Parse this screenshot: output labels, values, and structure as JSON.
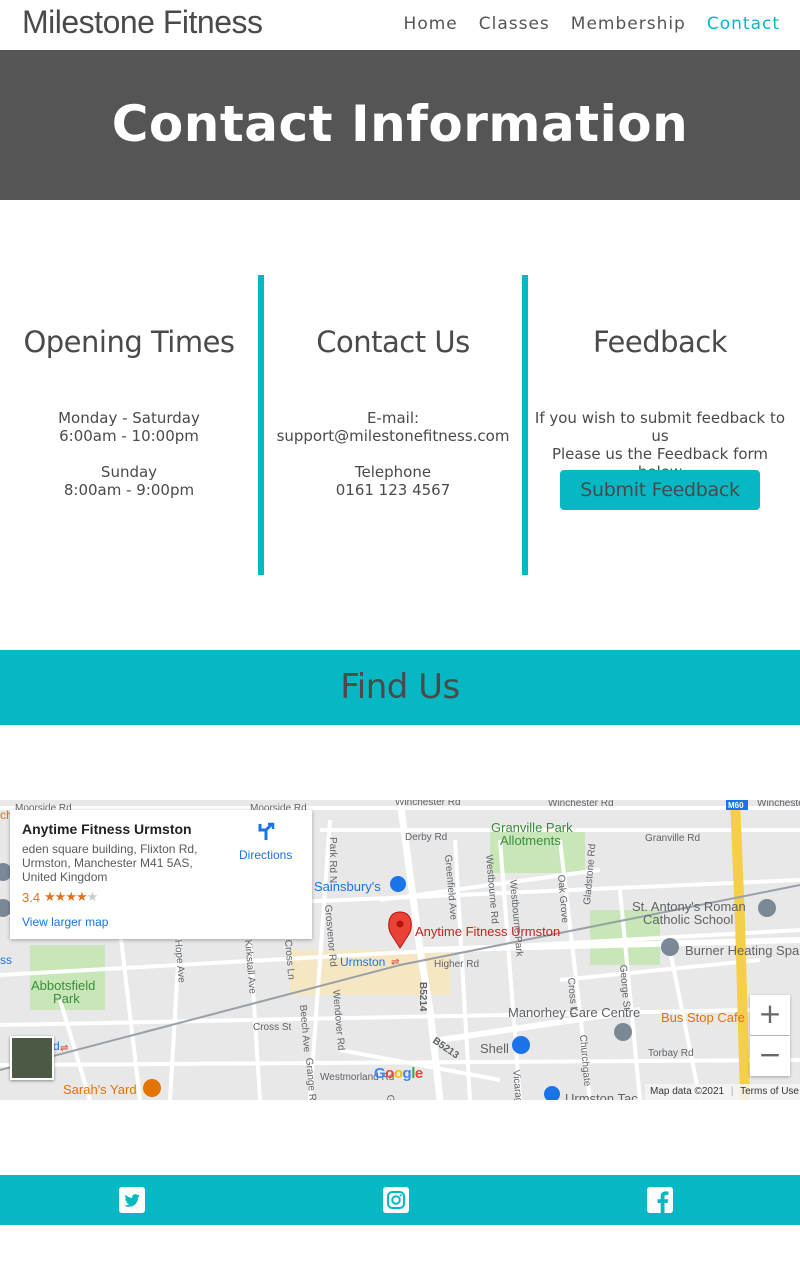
{
  "nav": {
    "brand": "Milestone Fitness",
    "links": [
      "Home",
      "Classes",
      "Membership",
      "Contact"
    ],
    "active": "Contact"
  },
  "hero": {
    "title": "Contact Information"
  },
  "opening": {
    "title": "Opening Times",
    "lines": [
      "Monday - Saturday",
      "6:00am - 10:00pm",
      "",
      "Sunday",
      "8:00am - 9:00pm"
    ]
  },
  "contact": {
    "title": "Contact Us",
    "lines": [
      "E-mail:",
      "support@milestonefitness.com",
      "",
      "Telephone",
      "0161 123 4567"
    ]
  },
  "feedback": {
    "title": "Feedback",
    "lines": [
      "If you wish to submit feedback to us",
      "Please us the Feedback form below"
    ],
    "button": "Submit Feedback"
  },
  "find": {
    "title": "Find Us"
  },
  "map": {
    "place_name": "Anytime Fitness Urmston",
    "address": "eden square building, Flixton Rd, Urmston, Manchester M41 5AS, United Kingdom",
    "rating": "3.4",
    "rating_value": 3.4,
    "rating_max": 5,
    "larger_map": "View larger map",
    "directions": "Directions",
    "marker_label": "Anytime Fitness Urmston",
    "google": "Google",
    "map_data": "Map data ©2021",
    "terms": "Terms of Use",
    "zoom_in": "+",
    "zoom_out": "−",
    "labels": {
      "moorside1": "Moorside Rd",
      "moorside2": "Moorside Rd",
      "winchester1": "Winchester Rd",
      "winchester2": "Winchester Rd",
      "winchester3": "Winchester",
      "m60": "M60",
      "derby": "Derby Rd",
      "park": "Park Rd N",
      "granville_park": "Granville Park",
      "allotments": "Allotments",
      "granville_rd": "Granville Rd",
      "sainsburys": "Sainsbury's",
      "greenfield": "Greenfield Ave",
      "westbourne": "Westbourne Rd",
      "westbourne_park": "Westbourne Park",
      "oak_grove": "Oak Grove",
      "gladstone": "Gladstone Rd",
      "st_antonys_1": "St. Antony's Roman",
      "st_antonys_2": "Catholic School",
      "burner": "Burner Heating Spa",
      "urmston": "Urmston",
      "higher_rd": "Higher Rd",
      "b5214": "B5214",
      "b5213": "B5213",
      "abbotsfield_1": "Abbotsfield",
      "abbotsfield_2": "Park",
      "grosvenor": "Grosvenor Rd",
      "manorhey": "Manorhey Care Centre",
      "bus_stop": "Bus Stop Cafe",
      "shell": "Shell",
      "cross_st": "Cross St",
      "beech": "Beech Ave",
      "wendover": "Wendover Rd",
      "grange": "Grange Rd",
      "westmorland": "Westmorland Rd",
      "torbay": "Torbay Rd",
      "george": "George St",
      "cross_ln": "Cross Ln",
      "churchgate": "Churchgate",
      "sarahs": "Sarah's Yard",
      "urmston_tac": "Urmston Tac",
      "vicarage": "Vicarage Rd",
      "kirkstall": "Kirkstall Ave",
      "hope": "Hope Ave",
      "edge_ch": "ch",
      "edge_d": "d",
      "edge_ss": "ss"
    }
  },
  "social": [
    "twitter-icon",
    "instagram-icon",
    "facebook-icon"
  ],
  "colors": {
    "accent": "#05b8c4",
    "hero_bg": "#555555",
    "text": "#4a4a4a"
  }
}
